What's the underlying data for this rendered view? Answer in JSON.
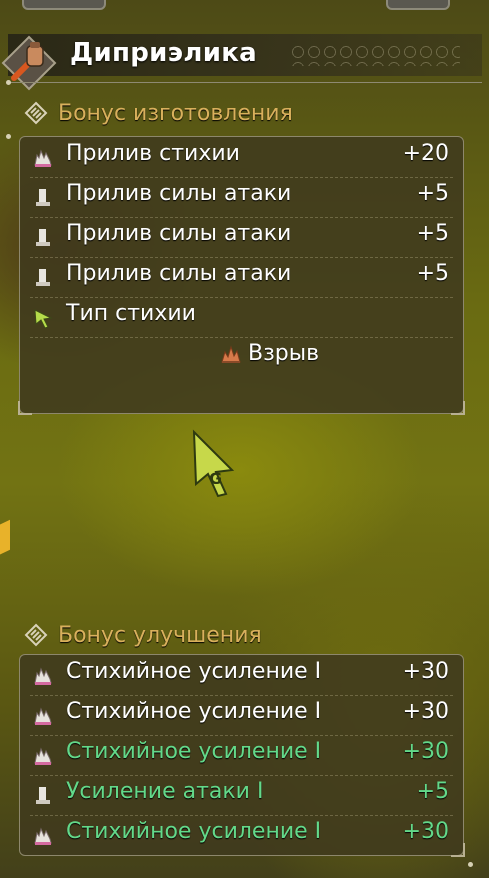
{
  "weapon": {
    "name": "Диприэлика",
    "icon": "weapon-category-icon"
  },
  "crafting_bonus": {
    "title": "Бонус изготовления",
    "icon": "bonus-diamond-icon",
    "rows": [
      {
        "icon": "element-surge-icon",
        "name": "Прилив стихии",
        "value": "+20"
      },
      {
        "icon": "attack-surge-icon",
        "name": "Прилив силы атаки",
        "value": "+5"
      },
      {
        "icon": "attack-surge-icon",
        "name": "Прилив силы атаки",
        "value": "+5"
      },
      {
        "icon": "attack-surge-icon",
        "name": "Прилив силы атаки",
        "value": "+5"
      },
      {
        "icon": "element-type-arrow-icon",
        "name": "Тип стихии",
        "value": ""
      }
    ],
    "element_type": {
      "icon": "blast-icon",
      "label": "Взрыв"
    }
  },
  "upgrade_bonus": {
    "title": "Бонус улучшения",
    "icon": "bonus-diamond-icon",
    "rows": [
      {
        "icon": "element-boost-icon",
        "name": "Стихийное усиление I",
        "value": "+30",
        "highlight": false
      },
      {
        "icon": "element-boost-icon",
        "name": "Стихийное усиление I",
        "value": "+30",
        "highlight": false
      },
      {
        "icon": "element-boost-icon",
        "name": "Стихийное усиление I",
        "value": "+30",
        "highlight": true
      },
      {
        "icon": "attack-boost-icon",
        "name": "Усиление атаки I",
        "value": "+5",
        "highlight": true
      },
      {
        "icon": "element-boost-icon",
        "name": "Стихийное усиление I",
        "value": "+30",
        "highlight": true
      }
    ]
  },
  "cursor": {
    "icon": "pointer-cursor-icon",
    "letter": "G"
  },
  "colors": {
    "section_title": "#d9b05c",
    "highlight_text": "#63d98a",
    "text": "#ffffff"
  }
}
